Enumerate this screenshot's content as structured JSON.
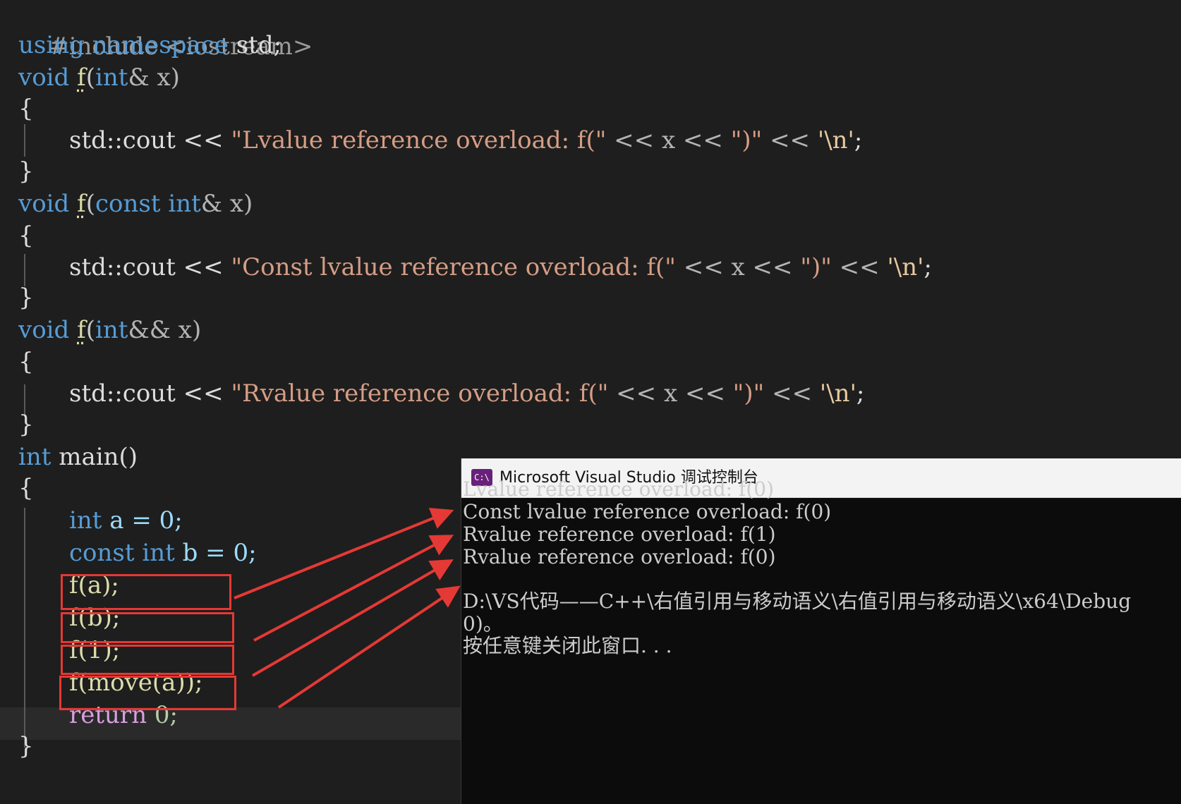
{
  "code": {
    "include": "#include <iostream>",
    "using": [
      "using",
      "namespace",
      "std;"
    ],
    "fn_decls": [
      {
        "void": "void",
        "name": "f",
        "param_kw": "int",
        "param_kw2": "",
        "param_rest": "& x)",
        "open": "("
      },
      {
        "void": "void",
        "name": "f",
        "param_kw": "const",
        "param_kw2": "int",
        "param_rest": "& x)",
        "open": "("
      },
      {
        "void": "void",
        "name": "f",
        "param_kw": "int",
        "param_kw2": "",
        "param_rest": "&& x)",
        "open": "("
      }
    ],
    "open_brace": "{",
    "close_brace": "}",
    "cout_prefix": "std::cout << ",
    "cout_strings": [
      "\"Lvalue reference overload: f(\"",
      "\"Const lvalue reference overload: f(\"",
      "\"Rvalue reference overload: f(\""
    ],
    "cout_mid": " << x << ",
    "cout_close_str": "\")\"",
    "cout_shift2": " << ",
    "newline_char": "'\\n'",
    "semicolon": ";",
    "main_kw": "int",
    "main_name": " main()",
    "var_a": {
      "kw": "int",
      "rest": " a = 0;"
    },
    "var_b": {
      "kw": "const int",
      "rest": " b = 0;"
    },
    "calls": [
      "f(a);",
      "f(b);",
      "f(1);",
      "f(move(a));"
    ],
    "return_kw": "return",
    "return_rest": " 0;"
  },
  "console": {
    "title": "Microsoft Visual Studio 调试控制台",
    "icon_text": "C:\\",
    "lines": [
      "Lvalue reference overload: f(0)",
      "Const lvalue reference overload: f(0)",
      "Rvalue reference overload: f(1)",
      "Rvalue reference overload: f(0)",
      "",
      "D:\\VS代码——C++\\右值引用与移动语义\\右值引用与移动语义\\x64\\Debug",
      "0)。",
      "按任意键关闭此窗口. . ."
    ]
  },
  "colors": {
    "annotation": "#e53935",
    "keyword": "#569cd6",
    "string": "#d69d85",
    "function": "#dcdcaa"
  }
}
